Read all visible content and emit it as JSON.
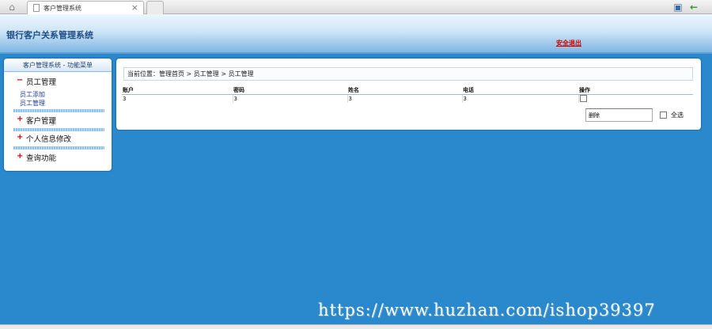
{
  "browser": {
    "tab_title": "客户管理系统",
    "tab_close": "×",
    "icons": {
      "home": "home-icon",
      "document": "document-icon",
      "close": "close-icon",
      "page_tools": "page-tools-icon",
      "back": "back-arrow-icon"
    }
  },
  "header": {
    "system_title": "银行客户关系管理系统",
    "logout_label": "安全退出"
  },
  "sidebar": {
    "title": "客户管理系统 - 功能菜单",
    "groups": [
      {
        "sign": "−",
        "label": "员工管理",
        "expanded": true,
        "items": [
          {
            "label": "员工添加"
          },
          {
            "label": "员工管理"
          }
        ]
      },
      {
        "sign": "+",
        "label": "客户管理",
        "expanded": false
      },
      {
        "sign": "+",
        "label": "个人信息修改",
        "expanded": false
      },
      {
        "sign": "+",
        "label": "查询功能",
        "expanded": false
      }
    ]
  },
  "main": {
    "breadcrumb": "当前位置：管理首页 > 员工管理 > 员工管理",
    "table": {
      "headers": [
        "账户",
        "密码",
        "姓名",
        "电话",
        "操作"
      ],
      "rows": [
        [
          "3",
          "3",
          "3",
          "3"
        ]
      ]
    },
    "delete_value": "删除",
    "select_all_label": "全选"
  },
  "watermark": "https://www.huzhan.com/ishop39397",
  "colors": {
    "page_background": "#2a88cc",
    "header_title": "#1d4f86",
    "logout": "#d40000",
    "menu_sign": "#cc0000",
    "sub_link": "#1a3f9b"
  }
}
